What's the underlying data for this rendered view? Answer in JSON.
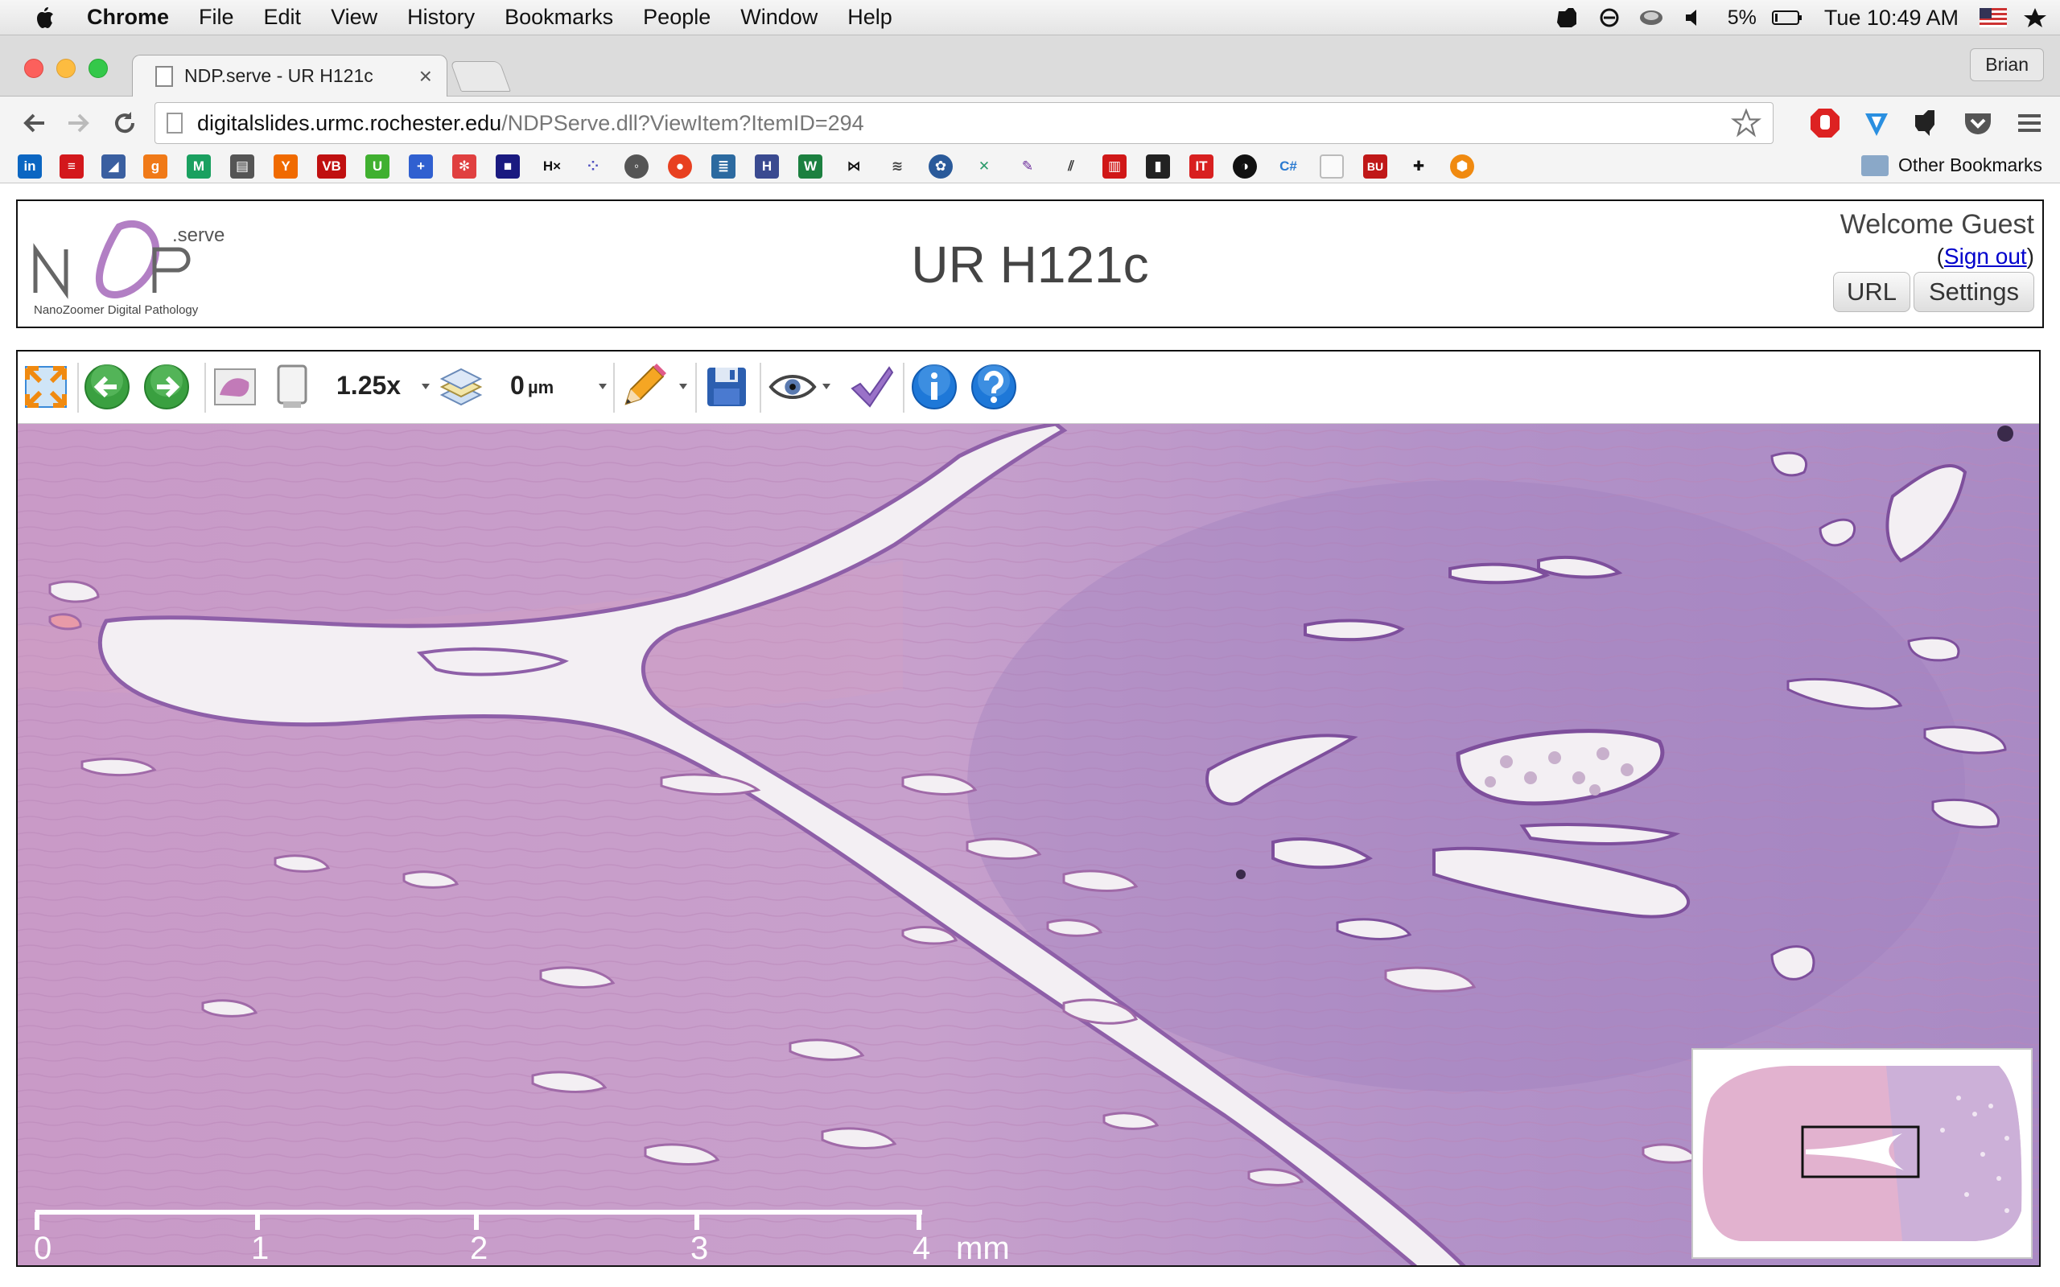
{
  "menubar": {
    "items": [
      "Chrome",
      "File",
      "Edit",
      "View",
      "History",
      "Bookmarks",
      "People",
      "Window",
      "Help"
    ],
    "battery": "5%",
    "clock": "Tue 10:49 AM"
  },
  "browser": {
    "tab_title": "NDP.serve - UR H121c",
    "tab_close": "×",
    "profile": "Brian",
    "url_host": "digitalslides.urmc.rochester.edu",
    "url_path": "/NDPServe.dll?ViewItem?ItemID=294",
    "other_bookmarks": "Other Bookmarks",
    "bookmark_labels": {
      "yc": "Y",
      "vb": "VB",
      "u": "U",
      "hx": "H×",
      "cs": "C#",
      "bu": "BU",
      "it": "IT"
    }
  },
  "header": {
    "logo_serve": ".serve",
    "logo_tagline": "NanoZoomer Digital Pathology",
    "title": "UR H121c",
    "welcome": "Welcome Guest",
    "signout_open": "(",
    "signout": "Sign out",
    "signout_close": ")",
    "url_button": "URL",
    "settings_button": "Settings"
  },
  "viewer": {
    "zoom": "1.25x",
    "focus": "0",
    "focus_unit": "µm",
    "scale_ticks": [
      "0",
      "1",
      "2",
      "3",
      "4"
    ],
    "scale_unit": "mm"
  },
  "colors": {
    "stroma": "#c99cc8",
    "lumen": "#f3eff3",
    "epithelium": "#8e5fa8",
    "accent_link": "#0000cc"
  }
}
